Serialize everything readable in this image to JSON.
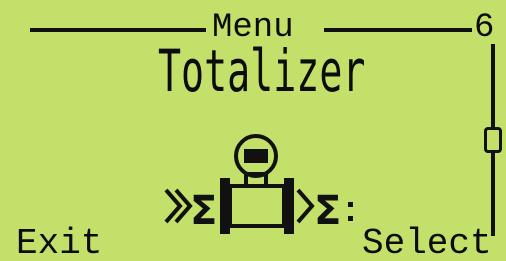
{
  "header": {
    "title": "Menu",
    "page_number": "6"
  },
  "item": {
    "title": "Totalizer",
    "icon": "flowmeter-totalizer-icon"
  },
  "softkeys": {
    "left": "Exit",
    "right": "Select"
  },
  "scrollbar": {
    "position": 0.5
  },
  "colors": {
    "lcd_background": "#c3e06a",
    "lcd_foreground": "#111111"
  }
}
